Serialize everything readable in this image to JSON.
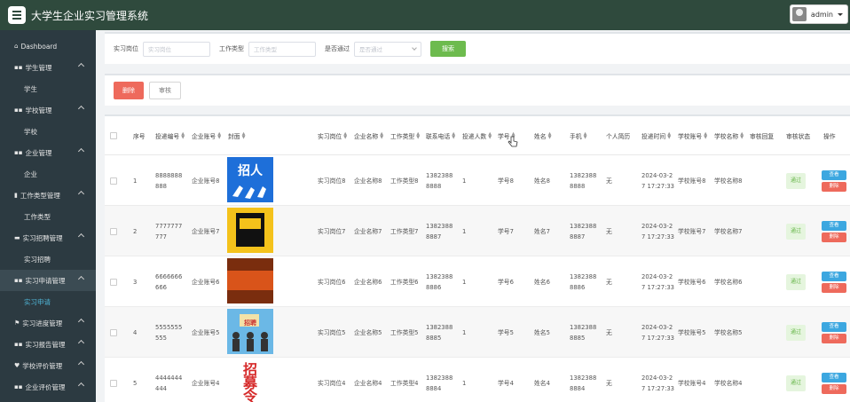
{
  "app": {
    "title": "大学生企业实习管理系统",
    "user": "admin"
  },
  "sidebar": {
    "items": [
      {
        "type": "item",
        "icon": "home-icon",
        "glyph": "⌂",
        "label": "Dashboard",
        "chevron": false
      },
      {
        "type": "item",
        "icon": "grid-icon",
        "glyph": "▪▪",
        "label": "学生管理",
        "chevron": true
      },
      {
        "type": "sub",
        "label": "学生"
      },
      {
        "type": "item",
        "icon": "grid-icon",
        "glyph": "▪▪",
        "label": "学校管理",
        "chevron": true
      },
      {
        "type": "sub",
        "label": "学校"
      },
      {
        "type": "item",
        "icon": "grid-icon",
        "glyph": "▪▪",
        "label": "企业管理",
        "chevron": true
      },
      {
        "type": "sub",
        "label": "企业"
      },
      {
        "type": "item",
        "icon": "chart-icon",
        "glyph": "▮",
        "label": "工作类型管理",
        "chevron": true
      },
      {
        "type": "sub",
        "label": "工作类型"
      },
      {
        "type": "item",
        "icon": "calendar-icon",
        "glyph": "▬",
        "label": "实习招聘管理",
        "chevron": true
      },
      {
        "type": "sub",
        "label": "实习招聘"
      },
      {
        "type": "item",
        "icon": "grid-icon",
        "glyph": "▪▪",
        "label": "实习申请管理",
        "chevron": true,
        "active": true
      },
      {
        "type": "sub",
        "label": "实习申请",
        "active": true
      },
      {
        "type": "item",
        "icon": "flag-icon",
        "glyph": "⚑",
        "label": "实习进度管理",
        "chevron": true
      },
      {
        "type": "item",
        "icon": "grid-icon",
        "glyph": "▪▪",
        "label": "实习报告管理",
        "chevron": true
      },
      {
        "type": "item",
        "icon": "heart-icon",
        "glyph": "♥",
        "label": "学校评价管理",
        "chevron": true
      },
      {
        "type": "item",
        "icon": "grid-icon",
        "glyph": "▪▪",
        "label": "企业评价管理",
        "chevron": true
      }
    ]
  },
  "search": {
    "position_label": "实习岗位",
    "position_placeholder": "实习岗位",
    "worktype_label": "工作类型",
    "worktype_placeholder": "工作类型",
    "passed_label": "是否通过",
    "passed_placeholder": "是否通过",
    "button": "搜索"
  },
  "actions": {
    "delete": "删除",
    "audit": "审核"
  },
  "table": {
    "headers": {
      "index": "序号",
      "apply_no": "投递编号",
      "company_no": "企业账号",
      "cover": "封面",
      "position": "实习岗位",
      "company_name": "企业名称",
      "work_type": "工作类型",
      "phone": "联系电话",
      "count": "投递人数",
      "student_no": "学号",
      "name": "姓名",
      "mobile": "手机",
      "resume": "个人简历",
      "time": "投递时间",
      "school_no": "学校账号",
      "school_name": "学校名称",
      "reply": "审核回复",
      "status": "审核状态",
      "op": "操作"
    },
    "rows": [
      {
        "index": "1",
        "apply_no": "8888888888",
        "company_no": "企业账号8",
        "position": "实习岗位8",
        "company_name": "企业名称8",
        "work_type": "工作类型8",
        "phone": "13823888888",
        "count": "1",
        "student_no": "学号8",
        "name": "姓名8",
        "mobile": "13823888888",
        "resume": "无",
        "time": "2024-03-27 17:27:33",
        "school_no": "学校账号8",
        "school_name": "学校名称8",
        "status": "通过",
        "cover_text": "招人"
      },
      {
        "index": "2",
        "apply_no": "7777777777",
        "company_no": "企业账号7",
        "position": "实习岗位7",
        "company_name": "企业名称7",
        "work_type": "工作类型7",
        "phone": "13823888887",
        "count": "1",
        "student_no": "学号7",
        "name": "姓名7",
        "mobile": "13823888887",
        "resume": "无",
        "time": "2024-03-27 17:27:33",
        "school_no": "学校账号7",
        "school_name": "学校名称7",
        "status": "通过",
        "cover_text": ""
      },
      {
        "index": "3",
        "apply_no": "6666666666",
        "company_no": "企业账号6",
        "position": "实习岗位6",
        "company_name": "企业名称6",
        "work_type": "工作类型6",
        "phone": "13823888886",
        "count": "1",
        "student_no": "学号6",
        "name": "姓名6",
        "mobile": "13823888886",
        "resume": "无",
        "time": "2024-03-27 17:27:33",
        "school_no": "学校账号6",
        "school_name": "学校名称6",
        "status": "通过",
        "cover_text": ""
      },
      {
        "index": "4",
        "apply_no": "5555555555",
        "company_no": "企业账号5",
        "position": "实习岗位5",
        "company_name": "企业名称5",
        "work_type": "工作类型5",
        "phone": "13823888885",
        "count": "1",
        "student_no": "学号5",
        "name": "姓名5",
        "mobile": "13823888885",
        "resume": "无",
        "time": "2024-03-27 17:27:33",
        "school_no": "学校账号5",
        "school_name": "学校名称5",
        "status": "通过",
        "cover_text": "招聘"
      },
      {
        "index": "5",
        "apply_no": "4444444444",
        "company_no": "企业账号4",
        "position": "实习岗位4",
        "company_name": "企业名称4",
        "work_type": "工作类型4",
        "phone": "13823888884",
        "count": "1",
        "student_no": "学号4",
        "name": "姓名4",
        "mobile": "13823888884",
        "resume": "无",
        "time": "2024-03-27 17:27:33",
        "school_no": "学校账号4",
        "school_name": "学校名称4",
        "status": "通过",
        "cover_text": "招募令"
      }
    ],
    "view_label": "查看",
    "delete_label": "删除"
  },
  "colors": {
    "topbar": "#2f4a3d",
    "sidebar": "#2c3a41",
    "accent": "#4fb6d8",
    "search_btn": "#6dbb4e",
    "danger": "#ee6a5c",
    "info": "#3ca7e0"
  }
}
